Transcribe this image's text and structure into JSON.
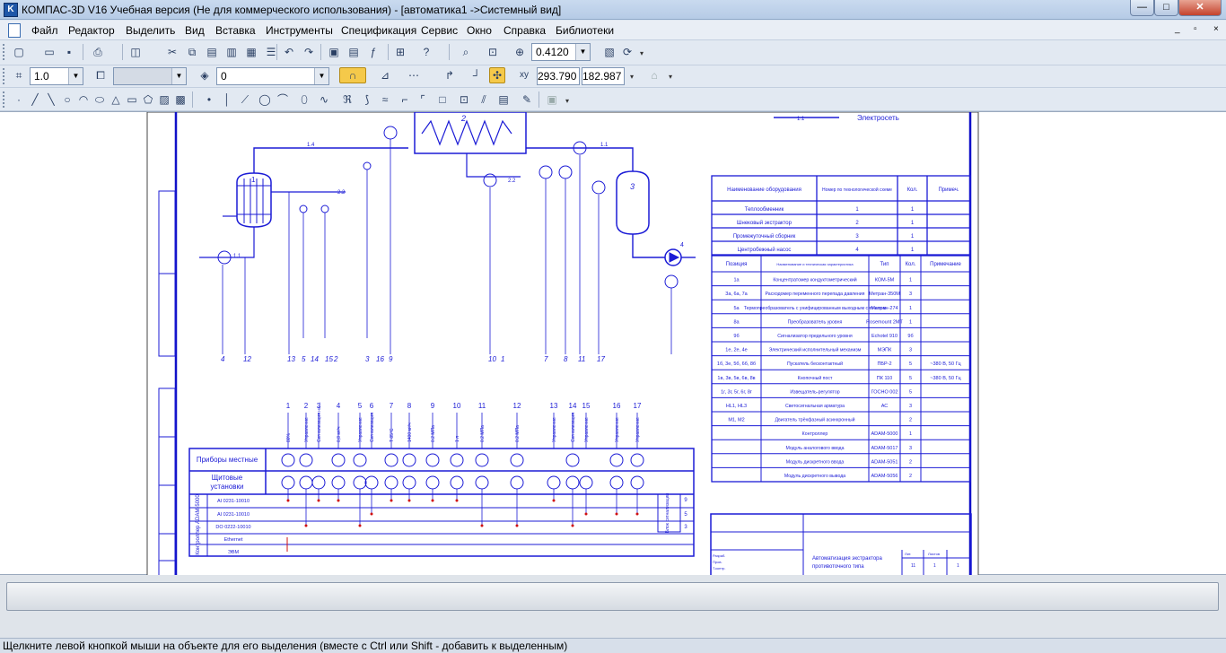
{
  "window": {
    "title": "КОМПАС-3D V16 Учебная версия  (Не для коммерческого использования) - [автоматика1 ->Системный вид]",
    "minimize": "—",
    "maximize": "□",
    "close": "✕"
  },
  "menu": {
    "items": [
      "Файл",
      "Редактор",
      "Выделить",
      "Вид",
      "Вставка",
      "Инструменты",
      "Спецификация",
      "Сервис",
      "Окно",
      "Справка",
      "Библиотеки"
    ],
    "doc_controls": [
      "_",
      "▫",
      "×"
    ]
  },
  "toolbar1": {
    "zoom_value": "0.4120"
  },
  "toolbar2": {
    "step_value": "1.0",
    "style_value": "",
    "layer_value": "0",
    "coord_x": "293.790",
    "coord_y": "182.987"
  },
  "drawing": {
    "legend_top": "Электросеть",
    "equipment_table": {
      "headers": [
        "Наименование оборудования",
        "Номер по технологической схеме",
        "Кол.",
        "Примеч."
      ],
      "rows": [
        [
          "Теплообменник",
          "1",
          "1",
          ""
        ],
        [
          "Шнековый экстрактор",
          "2",
          "1",
          ""
        ],
        [
          "Промежуточный сборник",
          "3",
          "1",
          ""
        ],
        [
          "Центробежный насос",
          "4",
          "1",
          ""
        ]
      ]
    },
    "devices_table": {
      "headers": [
        "Позиция",
        "Наименование и техническая характеристика",
        "Тип",
        "Кол.",
        "Примечание"
      ],
      "rows": [
        [
          "1а",
          "Концентратомер кондуктометрический",
          "КОМ-5М",
          "1",
          ""
        ],
        [
          "3а, 6а, 7а",
          "Расходомер переменного перепада давления",
          "Метран-350М",
          "3",
          ""
        ],
        [
          "5а",
          "Термопреобразователь с унифицированным выходным сигналом",
          "Метран-274",
          "1",
          ""
        ],
        [
          "8а",
          "Преобразователь уровня",
          "Rosemount 2МТ",
          "1",
          ""
        ],
        [
          "9б",
          "Сигнализатор предельного уровня",
          "Echotel 910",
          "9б",
          ""
        ],
        [
          "1е, 2е, 4е",
          "Электрический исполнительный механизм",
          "МЭПК",
          "3",
          ""
        ],
        [
          "1б, 3е, 5б, 6б, 8б",
          "Пускатель бесконтактный",
          "ПБР-2",
          "5",
          "~380 В, 50 Гц"
        ],
        [
          "1в, 3в, 5в, 6в, 8в",
          "Кнопочный пост",
          "ПК 110",
          "5",
          "~380 В, 50 Гц"
        ],
        [
          "1г, 3г, 5г, 6г, 8г",
          "Извещатель-регулятор",
          "ГОСНО 002",
          "5",
          ""
        ],
        [
          "HL1, HL3",
          "Светосигнальная арматура",
          "АС",
          "3",
          ""
        ],
        [
          "М1, М2",
          "Двигатель трёхфазный асинхронный",
          "",
          "2",
          ""
        ],
        [
          "",
          "Контроллер",
          "ADAM-5000",
          "1",
          ""
        ],
        [
          "",
          "Модуль аналогового ввода",
          "ADAM-5017",
          "3",
          ""
        ],
        [
          "",
          "Модуль дискретного ввода",
          "ADAM-5051",
          "2",
          ""
        ],
        [
          "",
          "Модуль дискретного вывода",
          "ADAM-5056",
          "2",
          ""
        ]
      ]
    },
    "scheme": {
      "unit_labels": [
        "1",
        "2",
        "3",
        "4"
      ],
      "pipe_labels": [
        "1.1",
        "1.4",
        "2.2",
        "1.8",
        "1.1"
      ],
      "bottom_numbers": [
        "4",
        "12",
        "13",
        "5",
        "14",
        "15",
        "2",
        "3",
        "16",
        "9",
        "10",
        "1",
        "7",
        "8",
        "11",
        "17"
      ],
      "column_numbers": [
        "1",
        "2",
        "3",
        "4",
        "5",
        "6",
        "7",
        "8",
        "9",
        "10",
        "11",
        "12",
        "13",
        "14",
        "15",
        "16",
        "17"
      ],
      "column_headers": [
        "80%",
        "Управление",
        "Сигнализация на ...",
        "0,8 м³/ч",
        "Управление",
        "Сигнализация",
        "T 85°C",
        "1400 м³/ч",
        "0.2 МПа",
        "1 л",
        "0.2 МПа",
        "0.2 МПа",
        "Управление",
        "Сигнализация",
        "Управление",
        "Управление",
        "Управление"
      ],
      "row_local": "Приборы местные",
      "row_board": "Щитовые установки",
      "controller_label": "Контроллер ADAM-5000",
      "modules": [
        "AI 0231-10010",
        "AI 0231-10010",
        "DO 0222-10010",
        "Ethernet",
        "ЭВМ"
      ],
      "right_note": "Блок сигнализации",
      "legend_side": [
        "9",
        "5",
        "3"
      ]
    },
    "stamp": {
      "title_lines": [
        "Автоматизация экстрактора",
        "противоточного типа"
      ],
      "cells": [
        "Лит.",
        "Масса",
        "Листов",
        "Разраб.",
        "Пров.",
        "Т.контр.",
        "Н.контр.",
        "Утв.",
        "Изм.",
        "Лист",
        "№ докум.",
        "Подп.",
        "Дата",
        "11",
        "1",
        "1"
      ]
    },
    "left_frame_labels": [
      "Перв. примен.",
      "Справ. №",
      "Подп. и дата",
      "Инв. № дубл.",
      "Взам. инв. №",
      "Подп. и дата",
      "Инв. № подл."
    ]
  },
  "status": {
    "hint": "Щелкните левой кнопкой мыши на объекте для его выделения (вместе с Ctrl или Shift - добавить к выделенным)"
  }
}
